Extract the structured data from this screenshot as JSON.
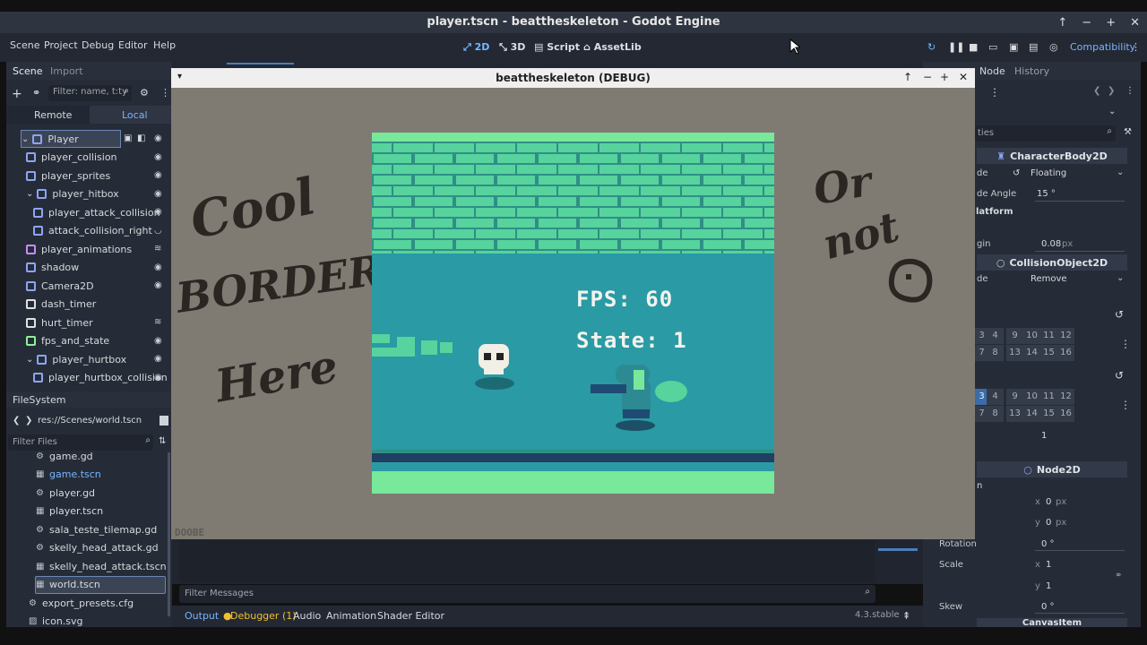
{
  "window": {
    "title": "player.tscn - beattheskeleton - Godot Engine",
    "controls": [
      "↑",
      "−",
      "+",
      "✕"
    ]
  },
  "menu": [
    "Scene",
    "Project",
    "Debug",
    "Editor",
    "Help"
  ],
  "workspaces": {
    "w2d": "2D",
    "w3d": "3D",
    "script": "Script",
    "assetlib": "AssetLib"
  },
  "renderer": "Compatibility",
  "scene_dock": {
    "tab_scene": "Scene",
    "tab_import": "Import",
    "filter_placeholder": "Filter: name, t:ty",
    "remote": "Remote",
    "local": "Local",
    "nodes": [
      {
        "label": "Player",
        "icon": "character-body-icon",
        "color": "#8da5f3"
      },
      {
        "label": "player_collision",
        "icon": "collision-shape-icon",
        "color": "#8da5f3"
      },
      {
        "label": "player_sprites",
        "icon": "animated-sprite-icon",
        "color": "#8da5f3"
      },
      {
        "label": "player_hitbox",
        "icon": "area2d-icon",
        "color": "#8da5f3"
      },
      {
        "label": "player_attack_collision",
        "icon": "collision-shape-icon",
        "color": "#8da5f3"
      },
      {
        "label": "attack_collision_right",
        "icon": "collision-shape-icon",
        "color": "#8da5f3"
      },
      {
        "label": "player_animations",
        "icon": "animation-player-icon",
        "color": "#c38ef1"
      },
      {
        "label": "shadow",
        "icon": "sprite-icon",
        "color": "#8da5f3"
      },
      {
        "label": "Camera2D",
        "icon": "camera-icon",
        "color": "#8da5f3"
      },
      {
        "label": "dash_timer",
        "icon": "timer-icon",
        "color": "#e0e0e0"
      },
      {
        "label": "hurt_timer",
        "icon": "timer-icon",
        "color": "#e0e0e0"
      },
      {
        "label": "fps_and_state",
        "icon": "label-icon",
        "color": "#8eef97"
      },
      {
        "label": "player_hurtbox",
        "icon": "area2d-icon",
        "color": "#8da5f3"
      },
      {
        "label": "player_hurtbox_collision",
        "icon": "collision-shape-icon",
        "color": "#8da5f3"
      }
    ]
  },
  "filesystem": {
    "title": "FileSystem",
    "path": "res://Scenes/world.tscn",
    "filter_placeholder": "Filter Files",
    "files": [
      {
        "name": "game.gd",
        "icon": "gear-icon"
      },
      {
        "name": "game.tscn",
        "icon": "scene-icon"
      },
      {
        "name": "player.gd",
        "icon": "gear-icon"
      },
      {
        "name": "player.tscn",
        "icon": "scene-icon"
      },
      {
        "name": "sala_teste_tilemap.gd",
        "icon": "gear-icon"
      },
      {
        "name": "skelly_head_attack.gd",
        "icon": "gear-icon"
      },
      {
        "name": "skelly_head_attack.tscn",
        "icon": "scene-icon"
      },
      {
        "name": "world.tscn",
        "icon": "scene-icon"
      },
      {
        "name": "export_presets.cfg",
        "icon": "file-icon"
      },
      {
        "name": "icon.svg",
        "icon": "image-icon"
      }
    ]
  },
  "debug_window": {
    "title": "beattheskeleton (DEBUG)",
    "left_text": [
      "Cool",
      "BORDER",
      "Here"
    ],
    "right_text": [
      "Or",
      "not"
    ],
    "fps_label": "FPS: 60",
    "state_label": "State: 1",
    "corner_text": "DOOBE"
  },
  "inspector": {
    "tab_node": "Node",
    "tab_history": "History",
    "filter_placeholder": "ties",
    "sections": {
      "character_body": "CharacterBody2D",
      "collision_object": "CollisionObject2D",
      "node2d": "Node2D",
      "canvas_item": "CanvasItem"
    },
    "props": {
      "mode_label": "de",
      "mode_value": "Floating",
      "angle_label": "de Angle",
      "angle_value": "15 °",
      "platform_label": "latform",
      "margin_label": "gin",
      "margin_value": "0.08",
      "margin_unit": "px",
      "disable_label": "de",
      "disable_value": "Remove",
      "priority_value": "1",
      "transform_label": "n",
      "pos_x": "0",
      "pos_y": "0",
      "pos_unit": "px",
      "rotation_label": "Rotation",
      "rotation_value": "0 °",
      "scale_label": "Scale",
      "scale_x": "1",
      "scale_y": "1",
      "skew_label": "Skew",
      "skew_value": "0 °"
    },
    "layer_row1": [
      "3",
      "4",
      "9",
      "10",
      "11",
      "12"
    ],
    "layer_row2": [
      "7",
      "8",
      "13",
      "14",
      "15",
      "16"
    ]
  },
  "bottom": {
    "filter_messages": "Filter Messages",
    "tabs": [
      "Output",
      "Debugger (1)",
      "Audio",
      "Animation",
      "Shader Editor"
    ],
    "version": "4.3.stable"
  },
  "colors": {
    "accent": "#78b5ff",
    "debugger_dot": "#f0c02c",
    "game_sky": "#2a9aa4",
    "game_brick": "#57d39d",
    "game_grass": "#78e89a"
  }
}
